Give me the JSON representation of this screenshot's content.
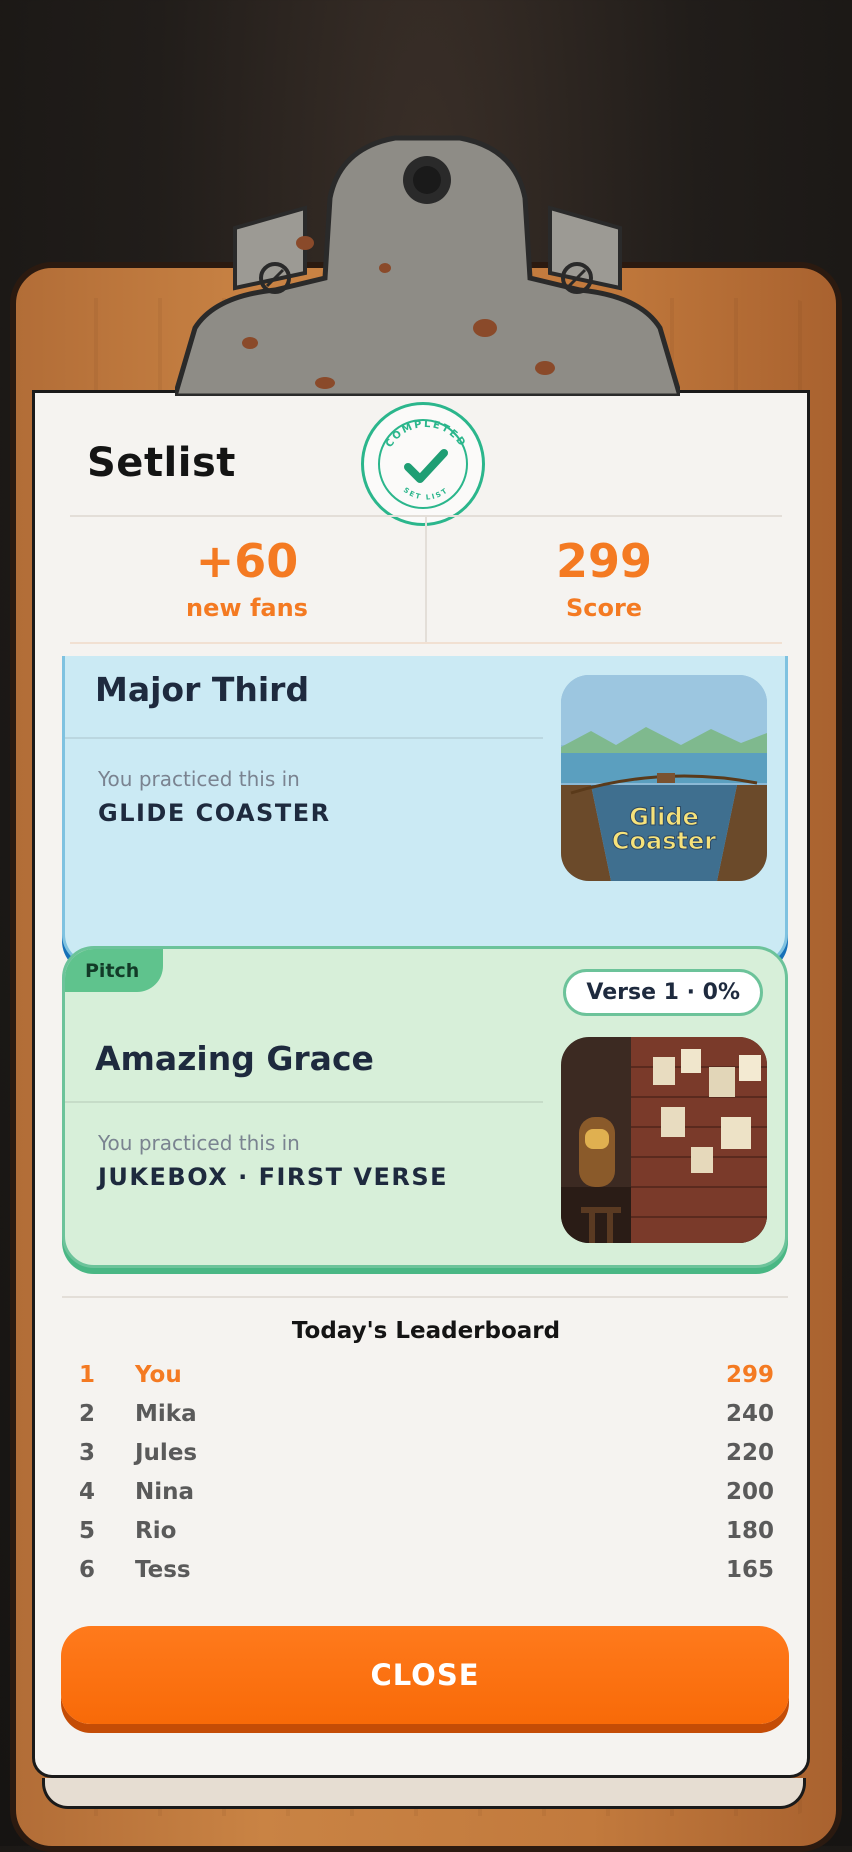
{
  "header": {
    "title": "Setlist"
  },
  "stamp": {
    "top_text": "COMPLETED",
    "bottom_text": "SET LIST",
    "color": "#2bb68c"
  },
  "stats": {
    "fans_value": "+60",
    "fans_label": "new fans",
    "score_value": "299",
    "score_label": "Score"
  },
  "cards": [
    {
      "name": "Major Third",
      "practiced_label": "You practiced this in",
      "game": "GLIDE COASTER",
      "thumb_title_line1": "Glide",
      "thumb_title_line2": "Coaster"
    },
    {
      "tag": "Pitch",
      "progress": "Verse 1 · 0%",
      "name": "Amazing Grace",
      "practiced_label": "You practiced this in",
      "game": "JUKEBOX · FIRST VERSE"
    }
  ],
  "leaderboard": {
    "title": "Today's Leaderboard",
    "rows": [
      {
        "rank": "1",
        "name": "You",
        "score": "299"
      },
      {
        "rank": "2",
        "name": "Mika",
        "score": "240"
      },
      {
        "rank": "3",
        "name": "Jules",
        "score": "220"
      },
      {
        "rank": "4",
        "name": "Nina",
        "score": "200"
      },
      {
        "rank": "5",
        "name": "Rio",
        "score": "180"
      },
      {
        "rank": "6",
        "name": "Tess",
        "score": "165"
      }
    ]
  },
  "close_label": "CLOSE",
  "colors": {
    "accent": "#f47a22",
    "blue_card": "#cbeaf4",
    "green_card": "#d7efd9",
    "button": "#f86a08"
  }
}
